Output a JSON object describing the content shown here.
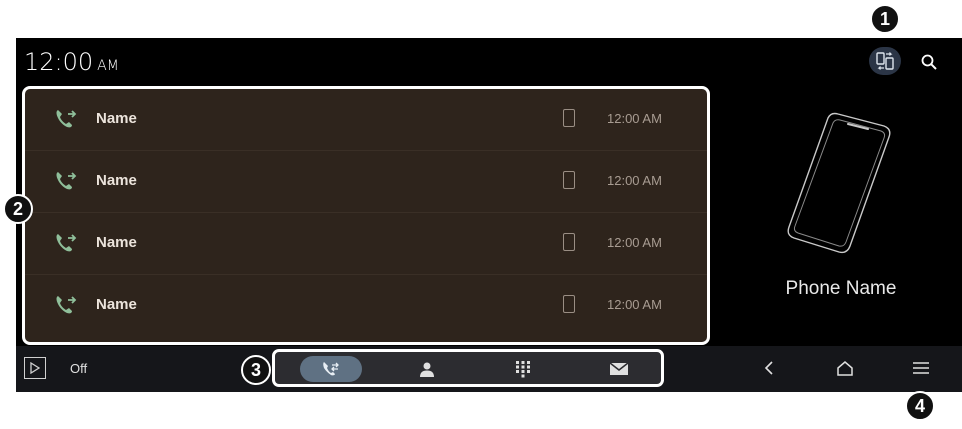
{
  "status_bar": {
    "time": "12:00",
    "ampm": "AM"
  },
  "header_actions": [
    {
      "icon": "phone-switch-icon"
    },
    {
      "icon": "search-icon"
    }
  ],
  "call_history": [
    {
      "icon": "outgoing-call-icon",
      "name": "Name",
      "device_icon": "mobile-device-icon",
      "time": "12:00 AM"
    },
    {
      "icon": "outgoing-call-icon",
      "name": "Name",
      "device_icon": "mobile-device-icon",
      "time": "12:00 AM"
    },
    {
      "icon": "outgoing-call-icon",
      "name": "Name",
      "device_icon": "mobile-device-icon",
      "time": "12:00 AM"
    },
    {
      "icon": "outgoing-call-icon",
      "name": "Name",
      "device_icon": "mobile-device-icon",
      "time": "12:00 AM"
    }
  ],
  "device": {
    "name": "Phone Name"
  },
  "bottom_bar": {
    "media_status": "Off",
    "tabs": [
      {
        "id": "recent",
        "icon": "call-history-icon",
        "active": true
      },
      {
        "id": "contacts",
        "icon": "contacts-icon",
        "active": false
      },
      {
        "id": "keypad",
        "icon": "keypad-icon",
        "active": false
      },
      {
        "id": "messages",
        "icon": "message-icon",
        "active": false
      }
    ],
    "nav": [
      "back-icon",
      "home-icon",
      "menu-icon"
    ]
  },
  "callouts": [
    "1",
    "2",
    "3",
    "4"
  ],
  "colors": {
    "list_bg": "#2e241c",
    "active_tab": "#5f7183",
    "screen_bg": "#000000",
    "accent_icon": "#8fbf9a"
  }
}
